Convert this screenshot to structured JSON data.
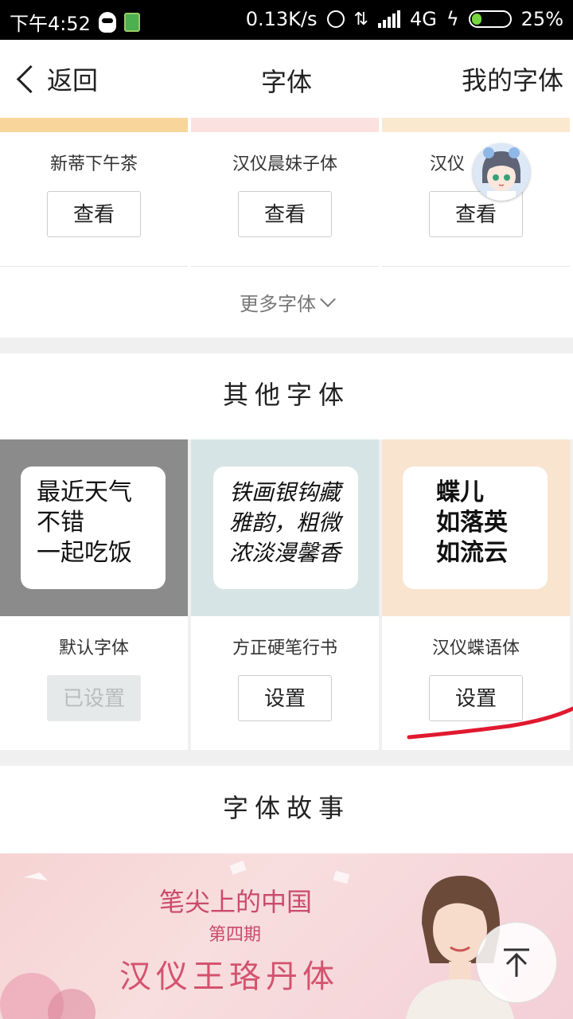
{
  "status_bar": {
    "time": "下午4:52",
    "network_speed": "0.13K/s",
    "network_type": "4G",
    "battery": "25%"
  },
  "nav": {
    "back_label": "返回",
    "title": "字体",
    "right_label": "我的字体"
  },
  "recommended_fonts": [
    {
      "name": "新蒂下午茶",
      "button": "查看",
      "strip_color": "#f7d59b"
    },
    {
      "name": "汉仪晨妹子体",
      "button": "查看",
      "strip_color": "#fbe2e0"
    },
    {
      "name": "汉仪",
      "button": "查看",
      "strip_color": "#fbe9cf"
    }
  ],
  "more_fonts_label": "更多字体",
  "other_fonts": {
    "title": "其他字体",
    "items": [
      {
        "name": "默认字体",
        "button": "已设置",
        "state": "set",
        "preview_bg": "#8b8b8b",
        "preview_lines": [
          "最近天气",
          "不错",
          "一起吃饭"
        ]
      },
      {
        "name": "方正硬笔行书",
        "button": "设置",
        "state": "available",
        "preview_bg": "#d7e4e6",
        "preview_lines": [
          "铁画银钩藏",
          "雅韵，粗微",
          "浓淡漫馨香"
        ]
      },
      {
        "name": "汉仪蝶语体",
        "button": "设置",
        "state": "available",
        "preview_bg": "#f8e4cf",
        "preview_lines": [
          "蝶儿",
          "如落英",
          "如流云"
        ]
      }
    ]
  },
  "font_stories": {
    "title": "字体故事",
    "banner_title": "笔尖上的中国",
    "banner_issue": "第四期",
    "banner_font": "汉仪王珞丹体"
  },
  "colors": {
    "accent_annotation": "#e0192f"
  }
}
